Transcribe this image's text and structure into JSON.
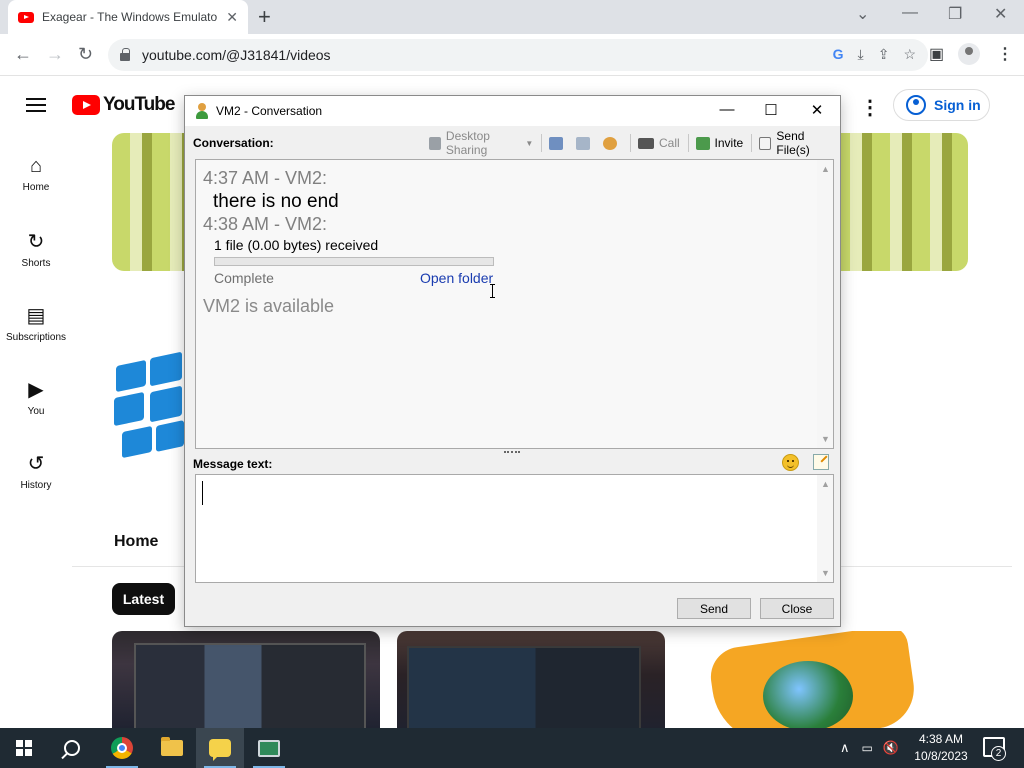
{
  "browser": {
    "tab_title": "Exagear - The Windows Emulato",
    "tab_close_glyph": "✕",
    "new_tab_glyph": "+",
    "url": "youtube.com/@J31841/videos",
    "window_controls": {
      "chevron": "⌄",
      "minimize": "—",
      "restore": "❐",
      "close": "✕"
    }
  },
  "youtube": {
    "logo_text": "YouTube",
    "sidebar": [
      {
        "label": "Home",
        "icon": "home-icon",
        "glyph": "⌂"
      },
      {
        "label": "Shorts",
        "icon": "shorts-icon",
        "glyph": "↻"
      },
      {
        "label": "Subscriptions",
        "icon": "subscriptions-icon",
        "glyph": "▤"
      },
      {
        "label": "You",
        "icon": "you-icon",
        "glyph": "▶"
      },
      {
        "label": "History",
        "icon": "history-icon",
        "glyph": "↺"
      }
    ],
    "sign_in": "Sign in",
    "more_glyph": "⋮",
    "channel_tab": "Home",
    "chip": "Latest"
  },
  "dialog": {
    "title": "VM2 - Conversation",
    "conversation_label": "Conversation:",
    "tools": {
      "desktop_sharing": "Desktop Sharing",
      "call": "Call",
      "invite": "Invite",
      "send_files": "Send File(s)"
    },
    "messages": {
      "first_header": "4:37 AM - VM2:",
      "first_text": "there is no end",
      "second_header": "4:38 AM - VM2:",
      "file_line": "1 file (0.00 bytes) received",
      "file_progress": 1.0,
      "file_status": "Complete",
      "open_folder": "Open folder",
      "presence": "VM2 is available"
    },
    "message_label": "Message text:",
    "message_value": "",
    "send_button": "Send",
    "close_button": "Close"
  },
  "taskbar": {
    "time": "4:38 AM",
    "date": "10/8/2023",
    "notification_count": "2",
    "tray_glyphs": {
      "chevron": "∧",
      "volume": "🔇"
    }
  },
  "colors": {
    "youtube_red": "#ff0000",
    "link_blue": "#1a3cb0",
    "taskbar_bg": "#1f2a33",
    "signin_blue": "#065fd4"
  }
}
